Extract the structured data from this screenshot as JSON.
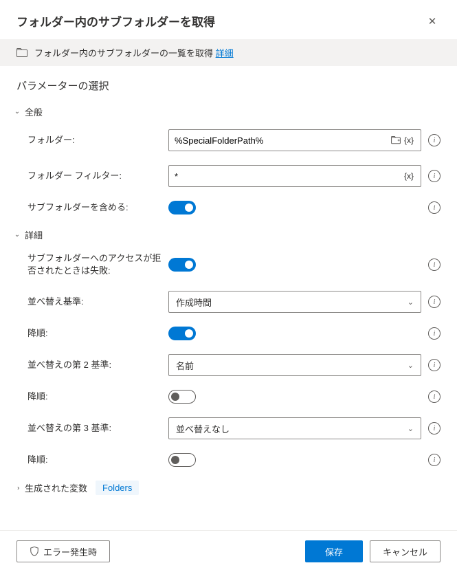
{
  "header": {
    "title": "フォルダー内のサブフォルダーを取得"
  },
  "banner": {
    "text": "フォルダー内のサブフォルダーの一覧を取得 ",
    "link": "詳細"
  },
  "sections": {
    "param_select": "パラメーターの選択",
    "general": "全般",
    "advanced": "詳細",
    "generated_vars": "生成された変数"
  },
  "fields": {
    "folder_label": "フォルダー:",
    "folder_value": "%SpecialFolderPath%",
    "filter_label": "フォルダー フィルター:",
    "filter_value": "*",
    "include_sub_label": "サブフォルダーを含める:",
    "fail_on_deny_label": "サブフォルダーへのアクセスが拒否されたときは失敗:",
    "sort1_label": "並べ替え基準:",
    "sort1_value": "作成時間",
    "desc1_label": "降順:",
    "sort2_label": "並べ替えの第 2 基準:",
    "sort2_value": "名前",
    "desc2_label": "降順:",
    "sort3_label": "並べ替えの第 3 基準:",
    "sort3_value": "並べ替えなし",
    "desc3_label": "降順:"
  },
  "variables": {
    "folders": "Folders"
  },
  "footer": {
    "on_error": "エラー発生時",
    "save": "保存",
    "cancel": "キャンセル"
  }
}
